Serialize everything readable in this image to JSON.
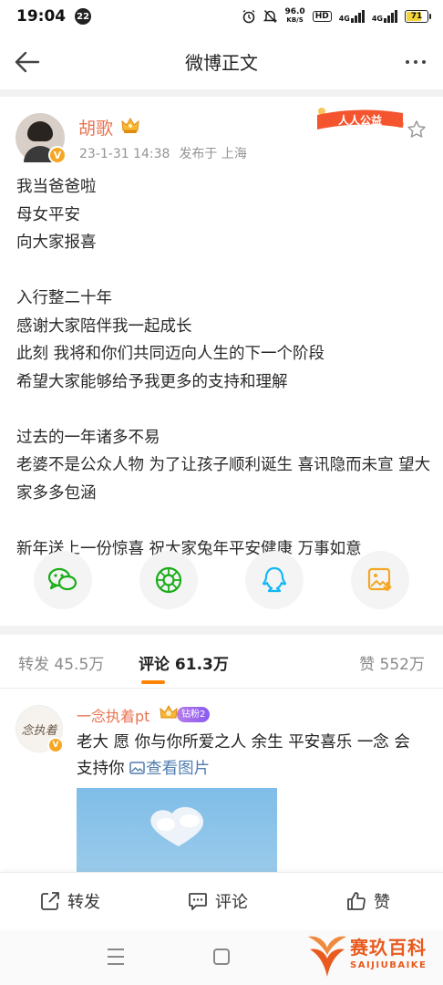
{
  "status_bar": {
    "time": "19:04",
    "notification_count": "22",
    "net_speed_value": "96.0",
    "net_speed_unit": "KB/S",
    "hd_label": "HD",
    "sig1_label": "4G",
    "sig2_label": "4G",
    "battery_level": "71",
    "battery_fraction": 0.71
  },
  "nav": {
    "title": "微博正文"
  },
  "post": {
    "author": "胡歌",
    "verified_mark": "V",
    "date": "23-1-31 14:38",
    "location": "发布于 上海",
    "charity_badge": "人人公益",
    "lines": [
      "我当爸爸啦",
      "母女平安",
      "向大家报喜",
      "",
      "入行整二十年",
      "感谢大家陪伴我一起成长",
      "此刻 我将和你们共同迈向人生的下一个阶段",
      "希望大家能够给予我更多的支持和理解",
      "",
      "过去的一年诸多不易",
      "老婆不是公众人物 为了让孩子顺利诞生 喜讯隐而未宣 望大家多多包涵",
      "",
      "新年送上一份惊喜 祝大家兔年平安健康 万事如意"
    ]
  },
  "share": {
    "icons": [
      "wechat-icon",
      "moments-icon",
      "qq-icon",
      "save-image-icon"
    ]
  },
  "tabs": {
    "repost": "转发 45.5万",
    "comment": "评论 61.3万",
    "like": "赞 552万"
  },
  "comment": {
    "avatar_text": "念执着",
    "verified_mark": "V",
    "author": "一念执着pt",
    "fan_badge": "钻粉2",
    "text": "老大 愿 你与你所爱之人 余生 平安喜乐 一念 会 支持你 ",
    "link_text": "查看图片"
  },
  "action_bar": {
    "repost": "转发",
    "comment": "评论",
    "like": "赞"
  },
  "watermark": {
    "title": "赛玖百科",
    "subtitle": "SAIJIUBAIKE"
  },
  "colors": {
    "accent": "#ff8200",
    "name_orange": "#eb7350",
    "link_blue": "#507daf",
    "wechat_green": "#1aad19",
    "qq_blue": "#12b7f5",
    "save_orange": "#f5a623"
  }
}
